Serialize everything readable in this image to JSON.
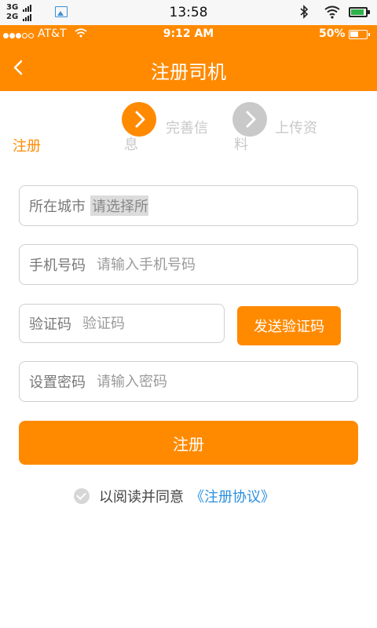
{
  "system_bar": {
    "signal_top": "3G",
    "signal_bottom": "2G",
    "time": "13:58",
    "icons": [
      "gallery-icon",
      "bluetooth-icon",
      "wifi-icon",
      "battery-icon"
    ]
  },
  "ios_bar": {
    "carrier": "AT&T",
    "time": "9:12 AM",
    "battery": "50%"
  },
  "header": {
    "title": "注册司机",
    "back_icon": "chevron-left-icon"
  },
  "steps": {
    "step1": "注册",
    "step2_line1": "完善信",
    "step2_line2": "息",
    "step3_line1": "上传资",
    "step3_line2": "料"
  },
  "form": {
    "city_label": "所在城市",
    "city_select": "请选择所",
    "phone_label": "手机号码",
    "phone_placeholder": "请输入手机号码",
    "code_label": "验证码",
    "code_placeholder": "验证码",
    "send_code": "发送验证码",
    "pwd_label": "设置密码",
    "pwd_placeholder": "请输入密码",
    "submit": "注册"
  },
  "agreement": {
    "text": "以阅读并同意",
    "link": "《注册协议》"
  },
  "colors": {
    "accent": "#ff8a00",
    "link": "#2a8fe0",
    "inactive": "#c9c9c9"
  }
}
